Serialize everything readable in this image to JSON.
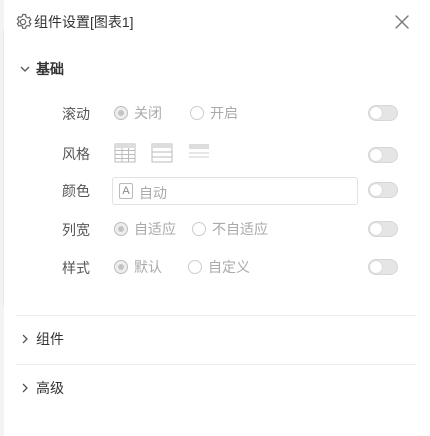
{
  "panel": {
    "title": "组件设置[图表1]",
    "icons": {
      "settings": "gear-icon",
      "close": "close-icon"
    }
  },
  "sections": {
    "basic": {
      "label": "基础",
      "expanded": true
    },
    "component": {
      "label": "组件",
      "expanded": false
    },
    "advanced": {
      "label": "高级",
      "expanded": false
    }
  },
  "settings": {
    "scroll": {
      "label": "滚动",
      "options": [
        "关闭",
        "开启"
      ],
      "selected": "关闭",
      "toggle_on": false
    },
    "style_grid": {
      "label": "风格",
      "icons": [
        "table-grid-icon",
        "table-rows-icon",
        "table-header-icon"
      ],
      "toggle_on": false
    },
    "color": {
      "label": "颜色",
      "value": "自动",
      "icon": "A",
      "toggle_on": false
    },
    "column_width": {
      "label": "列宽",
      "options": [
        "自适应",
        "不自适应"
      ],
      "selected": "自适应",
      "toggle_on": false
    },
    "style": {
      "label": "样式",
      "options": [
        "默认",
        "自定义"
      ],
      "selected": "默认",
      "toggle_on": false
    }
  },
  "colors": {
    "border": "#e2e2e2",
    "text": "#333333",
    "muted": "#aaaaaa",
    "toggle_off": "#e5e5e5"
  }
}
